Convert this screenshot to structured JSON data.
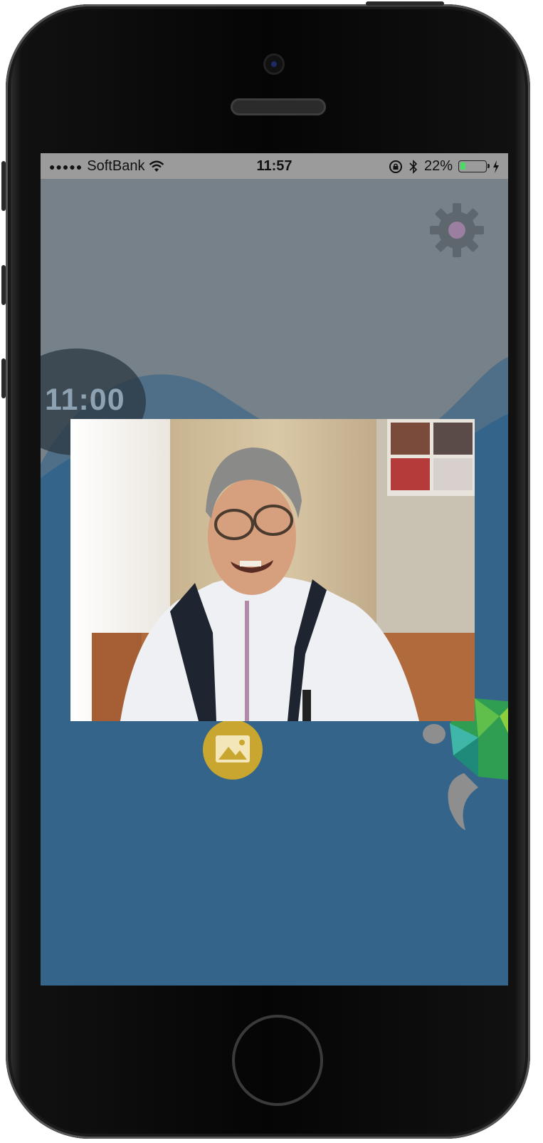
{
  "status_bar": {
    "signal_dots": "●●●●●",
    "carrier": "SoftBank",
    "time": "11:57",
    "battery_percent": "22%",
    "battery_level": 0.22
  },
  "timer": {
    "display": "11:00"
  },
  "icons": {
    "settings": "gear-icon",
    "gallery": "image-icon",
    "wifi": "wifi-icon",
    "bluetooth": "bluetooth-icon",
    "orientation_lock": "orientation-lock-icon",
    "charging": "lightning-icon",
    "mascot": "turtle-icon"
  },
  "colors": {
    "sky": "#768189",
    "sea": "#35648a",
    "accent_gold": "#c9a630",
    "status_bar": "#9b9b9b"
  }
}
